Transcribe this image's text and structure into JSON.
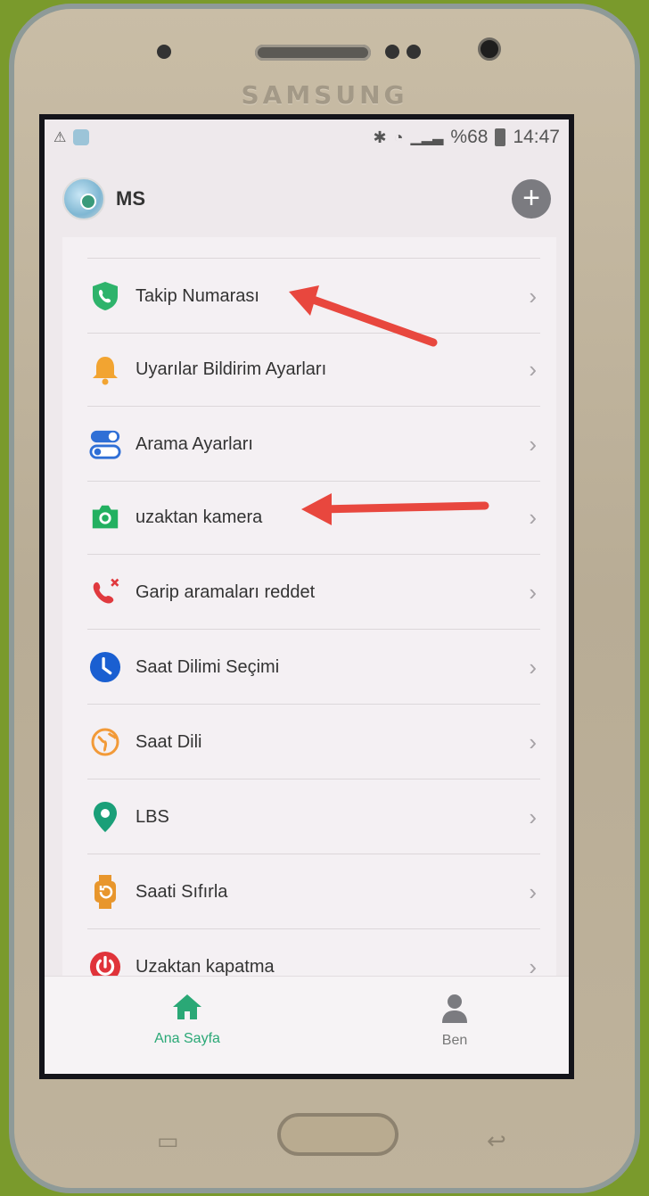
{
  "device": {
    "brand": "SAMSUNG"
  },
  "status_bar": {
    "battery": "%68",
    "time": "14:47"
  },
  "header": {
    "title": "MS"
  },
  "menu": {
    "items": [
      {
        "label": "Takip Numarası",
        "icon": "shield-phone-icon",
        "color": "#2eb36b"
      },
      {
        "label": "Uyarılar Bildirim Ayarları",
        "icon": "bell-icon",
        "color": "#f2a431"
      },
      {
        "label": "Arama Ayarları",
        "icon": "toggle-icon",
        "color": "#2f6fd6"
      },
      {
        "label": "uzaktan kamera",
        "icon": "camera-icon",
        "color": "#22b060"
      },
      {
        "label": "Garip aramaları reddet",
        "icon": "phone-reject-icon",
        "color": "#e0393e"
      },
      {
        "label": "Saat Dilimi Seçimi",
        "icon": "clock-icon",
        "color": "#1a5fd1"
      },
      {
        "label": "Saat Dili",
        "icon": "globe-icon",
        "color": "#f29a38"
      },
      {
        "label": "LBS",
        "icon": "location-pin-icon",
        "color": "#1a9f78"
      },
      {
        "label": "Saati Sıfırla",
        "icon": "watch-icon",
        "color": "#e8962c"
      },
      {
        "label": "Uzaktan kapatma",
        "icon": "power-icon",
        "color": "#e0333a"
      }
    ]
  },
  "bottom_nav": {
    "home_label": "Ana Sayfa",
    "me_label": "Ben",
    "active_color": "#2aa876"
  },
  "annotation_color": "#e8473e"
}
